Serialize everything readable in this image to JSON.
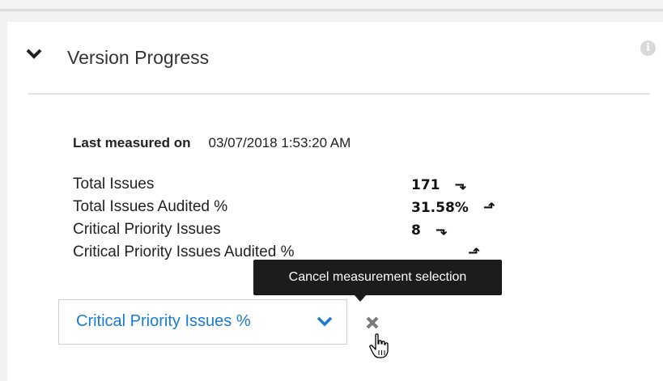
{
  "panel": {
    "title": "Version Progress",
    "collapse_icon": "chevron-down-icon",
    "info_icon": "info-icon",
    "info_glyph": "i"
  },
  "last_measured": {
    "label": "Last measured on",
    "value": "03/07/2018 1:53:20 AM"
  },
  "metrics": [
    {
      "name": "Total Issues",
      "value": "171",
      "trend": "down"
    },
    {
      "name": "Total Issues Audited %",
      "value": "31.58%",
      "trend": "up"
    },
    {
      "name": "Critical Priority Issues",
      "value": "8",
      "trend": "down"
    },
    {
      "name": "Critical Priority Issues Audited %",
      "value": "",
      "trend": "up"
    }
  ],
  "tooltip": {
    "text": "Cancel measurement selection"
  },
  "measurement_select": {
    "selected": "Critical Priority Issues %",
    "icon": "chevron-down-icon"
  },
  "cancel_button": {
    "icon": "close-icon"
  },
  "colors": {
    "accent": "#1a7bd0",
    "tooltip_bg": "#1c1c1c"
  }
}
